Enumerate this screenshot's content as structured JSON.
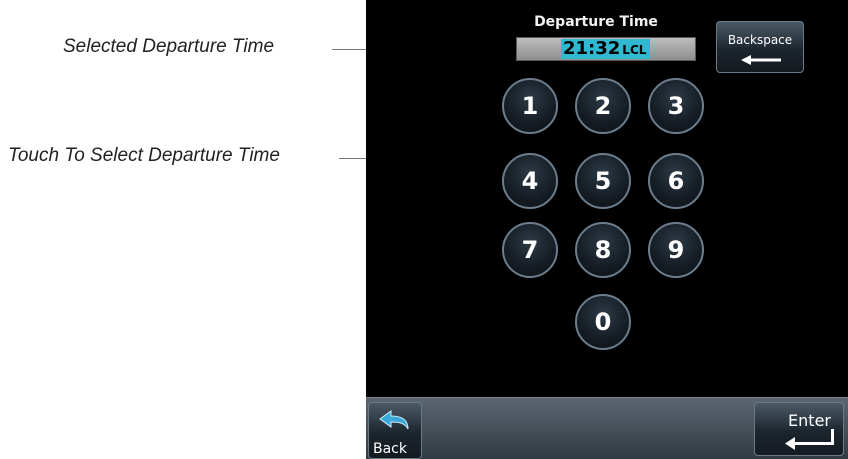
{
  "callouts": {
    "selected_time": "Selected Departure Time",
    "touch_select": "Touch To Select Departure Time"
  },
  "screen": {
    "title": "Departure Time",
    "time_value": "21:32",
    "time_unit": "LCL",
    "backspace_label": "Backspace",
    "keys": [
      "1",
      "2",
      "3",
      "4",
      "5",
      "6",
      "7",
      "8",
      "9",
      "0"
    ],
    "back_label": "Back",
    "enter_label": "Enter"
  },
  "colors": {
    "highlight": "#2fb8d0",
    "screen_bg": "#000000",
    "key_border": "#6b7d8c"
  }
}
